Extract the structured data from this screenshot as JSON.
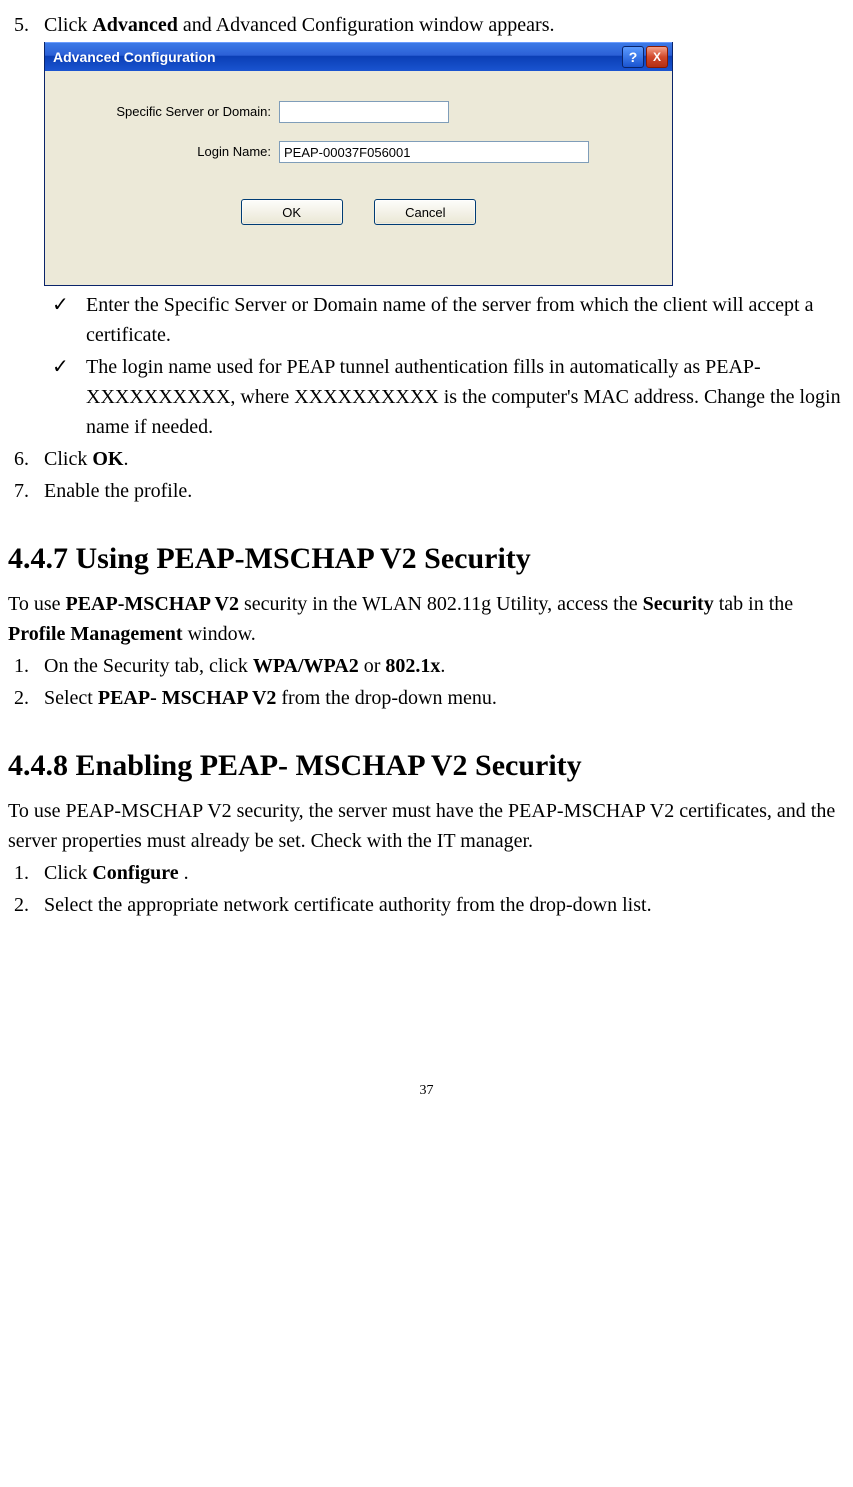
{
  "step5": {
    "num": "5.",
    "prefix": "Click ",
    "bold": "Advanced",
    "suffix": " and Advanced Configuration window appears."
  },
  "dialog": {
    "title": "Advanced Configuration",
    "help": "?",
    "close": "X",
    "label_server": "Specific Server or Domain:",
    "value_server": "",
    "label_login": "Login Name:",
    "value_login": "PEAP-00037F056001",
    "ok": "OK",
    "cancel": "Cancel"
  },
  "checks": {
    "mark": "✓",
    "c1": "Enter the Specific Server or Domain name of the server from which the client will accept a certificate.",
    "c2": "The login name used for PEAP tunnel authentication fills in automatically as PEAP-XXXXXXXXXX, where XXXXXXXXXX is the computer's MAC address. Change the login name if needed."
  },
  "step6": {
    "num": "6.",
    "prefix": "Click ",
    "bold": "OK",
    "suffix": "."
  },
  "step7": {
    "num": "7.",
    "text": "Enable the profile."
  },
  "h447": "4.4.7 Using PEAP-MSCHAP V2 Security",
  "p447": {
    "t1": "To use ",
    "b1": "PEAP-MSCHAP V2",
    "t2": " security in the WLAN 802.11g Utility, access the ",
    "b2": "Security",
    "t3": " tab in the ",
    "b3": "Profile Management",
    "t4": " window."
  },
  "s447_1": {
    "num": "1.",
    "t1": "On the Security tab, click ",
    "b1": "WPA/WPA2",
    "t2": " or ",
    "b2": "802.1x",
    "t3": "."
  },
  "s447_2": {
    "num": "2.",
    "t1": "Select ",
    "b1": "PEAP- MSCHAP V2",
    "t2": " from the drop-down menu."
  },
  "h448": "4.4.8 Enabling PEAP- MSCHAP V2 Security",
  "p448": "To use PEAP-MSCHAP V2 security, the server must have the PEAP-MSCHAP V2 certificates, and the server properties must already be set. Check with the IT manager.",
  "s448_1": {
    "num": "1.",
    "t1": "Click ",
    "b1": "Configure",
    "t2": " ."
  },
  "s448_2": {
    "num": "2.",
    "text": "Select the appropriate network certificate authority from the drop-down list."
  },
  "page": "37"
}
